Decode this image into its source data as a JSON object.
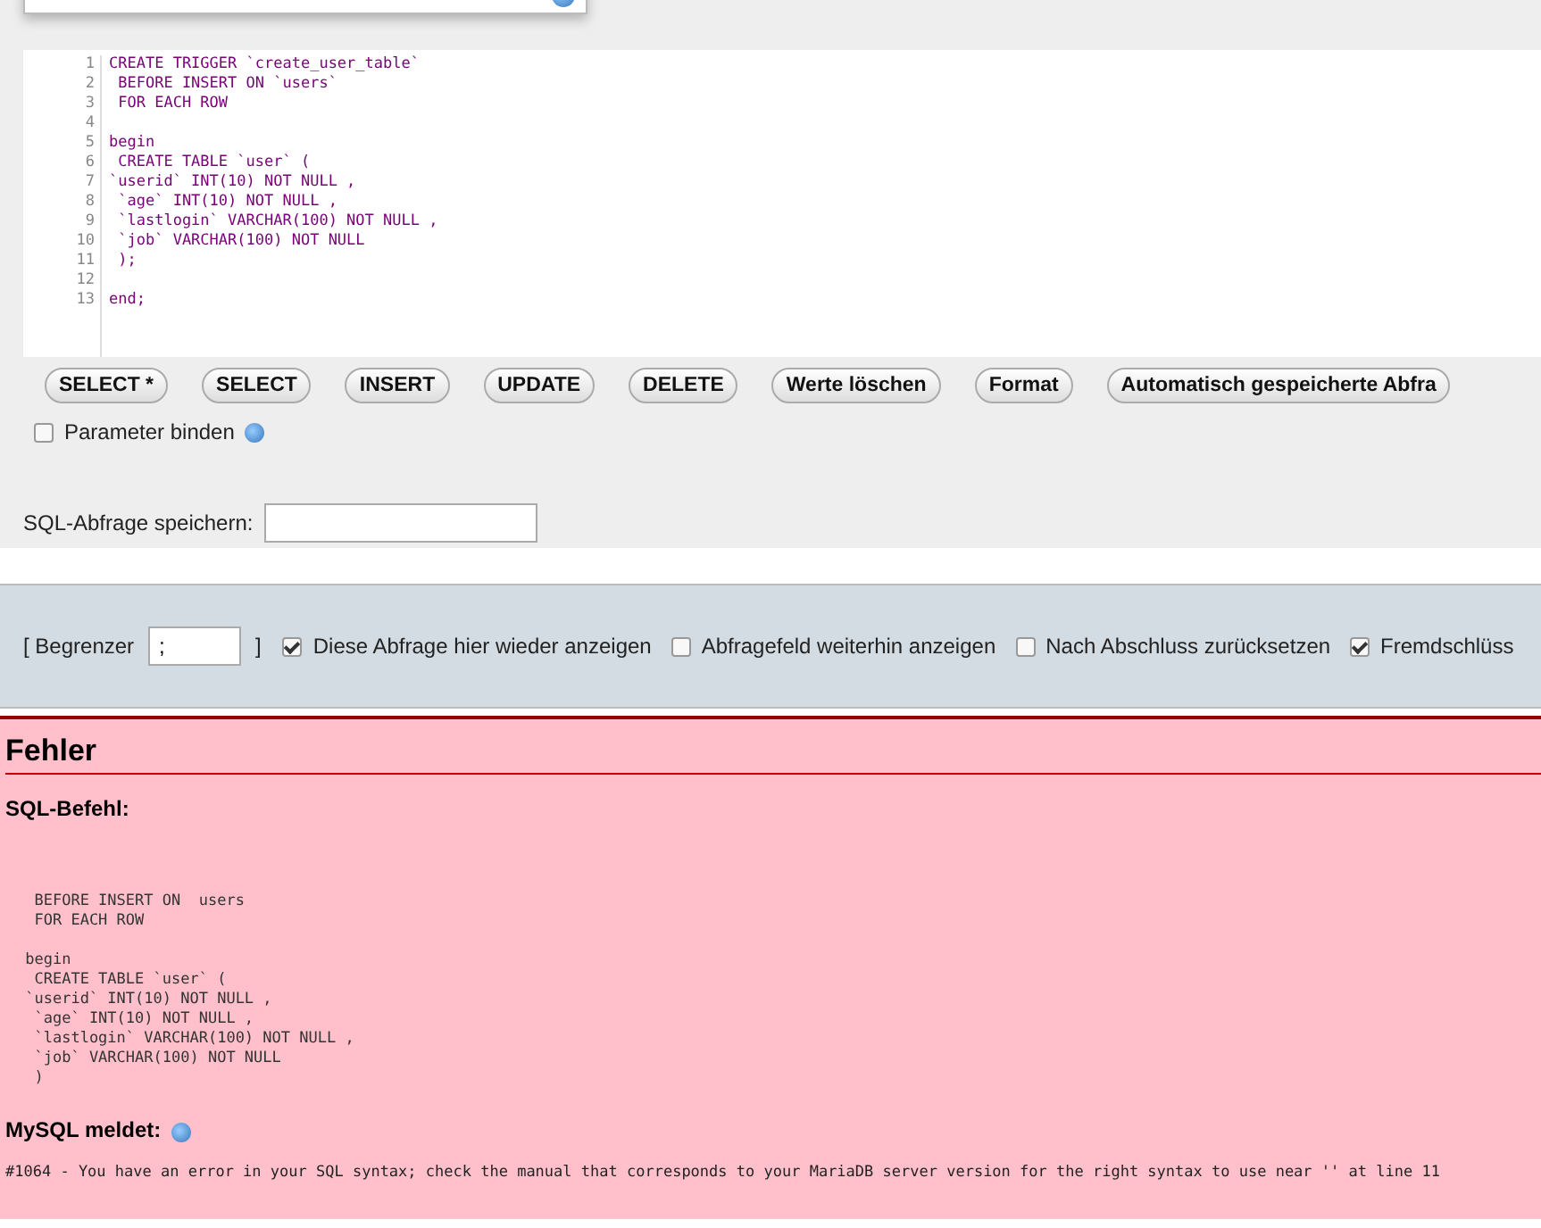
{
  "editor": {
    "lines": [
      {
        "number": "1",
        "code": "CREATE TRIGGER `create_user_table`"
      },
      {
        "number": "2",
        "code": " BEFORE INSERT ON `users`"
      },
      {
        "number": "3",
        "code": " FOR EACH ROW"
      },
      {
        "number": "4"
      },
      {
        "number": "5",
        "code": "begin"
      },
      {
        "number": "6",
        "code": " CREATE TABLE `user` ("
      },
      {
        "number": "7",
        "code": "`userid` INT(10) NOT NULL ,"
      },
      {
        "number": "8",
        "code": " `age` INT(10) NOT NULL ,"
      },
      {
        "number": "9",
        "code": " `lastlogin` VARCHAR(100) NOT NULL ,"
      },
      {
        "number": "10",
        "code": " `job` VARCHAR(100) NOT NULL"
      },
      {
        "number": "11",
        "code": " );"
      },
      {
        "number": "12"
      },
      {
        "number": "13",
        "code": "end;"
      }
    ]
  },
  "buttons": [
    "SELECT *",
    "SELECT",
    "INSERT",
    "UPDATE",
    "DELETE",
    "Werte löschen",
    "Format",
    "Automatisch gespeicherte Abfra"
  ],
  "bind_parameters": {
    "label": "Parameter binden",
    "checked": false
  },
  "save_query": {
    "label": "SQL-Abfrage speichern:"
  },
  "options": {
    "delimiter_open": "[ Begrenzer",
    "delimiter_value": ";",
    "delimiter_close": "]",
    "checkboxes": [
      {
        "label": "Diese Abfrage hier wieder anzeigen",
        "checked": true
      },
      {
        "label": "Abfragefeld weiterhin anzeigen",
        "checked": false
      },
      {
        "label": "Nach Abschluss zurücksetzen",
        "checked": false
      },
      {
        "label": "Fremdschlüss",
        "checked": true
      }
    ]
  },
  "error": {
    "title": "Fehler",
    "sql_heading": "SQL-Befehl:",
    "sql": "  BEFORE INSERT ON  users\n  FOR EACH ROW\n\n begin\n  CREATE TABLE `user` (\n `userid` INT(10) NOT NULL ,\n  `age` INT(10) NOT NULL ,\n  `lastlogin` VARCHAR(100) NOT NULL ,\n  `job` VARCHAR(100) NOT NULL\n  )",
    "server_heading": "MySQL meldet:",
    "message": "#1064 - You have an error in your SQL syntax; check the manual that corresponds to your MariaDB server version for the right syntax to use near '' at line 11"
  }
}
